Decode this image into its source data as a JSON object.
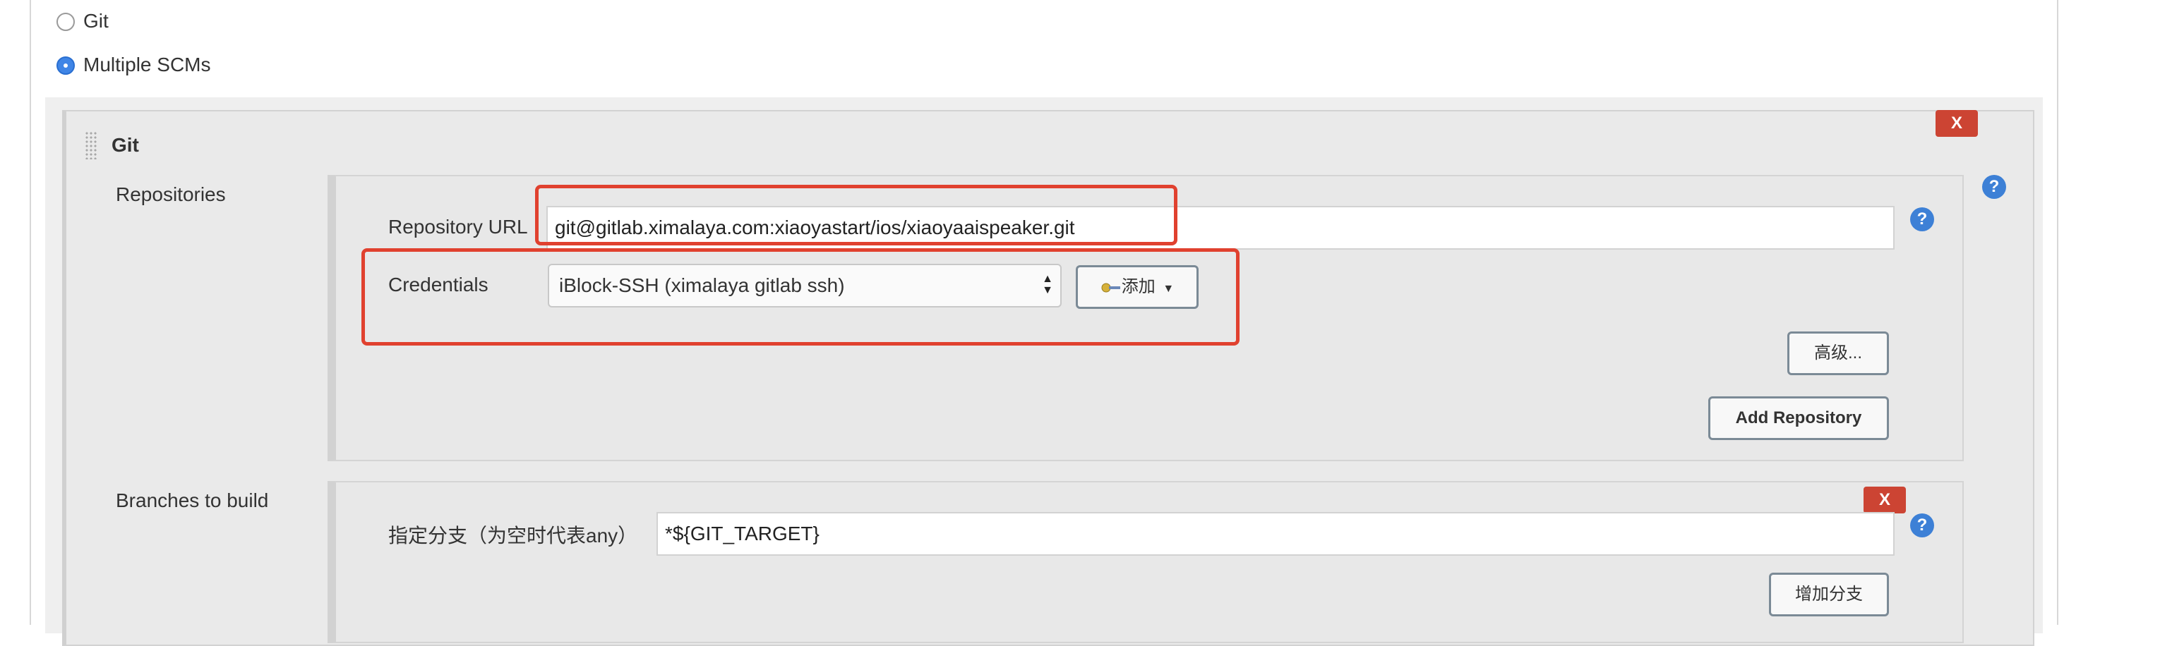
{
  "scm_options": {
    "git_label": "Git",
    "multiple_scms_label": "Multiple SCMs"
  },
  "git_block": {
    "title": "Git",
    "delete_label": "X",
    "repositories": {
      "label": "Repositories",
      "url_label": "Repository URL",
      "url_value": "git@gitlab.ximalaya.com:xiaoyastart/ios/xiaoyaaispeaker.git",
      "credentials_label": "Credentials",
      "credentials_selected": "iBlock-SSH (ximalaya gitlab ssh)",
      "add_label": "添加",
      "advanced_label": "高级...",
      "add_repository_label": "Add Repository"
    },
    "branches": {
      "label": "Branches to build",
      "delete_label": "X",
      "branch_label": "指定分支（为空时代表any）",
      "branch_value": "*${GIT_TARGET}",
      "add_branch_label": "增加分支"
    },
    "help_glyph": "?"
  },
  "colors": {
    "accent_blue": "#3d80d6",
    "delete_red": "#cc4433",
    "highlight_red": "#e0412f"
  },
  "icons": {
    "key": "key-icon",
    "dropdown": "caret-down-icon",
    "help": "help-icon",
    "drag": "drag-handle-icon"
  }
}
